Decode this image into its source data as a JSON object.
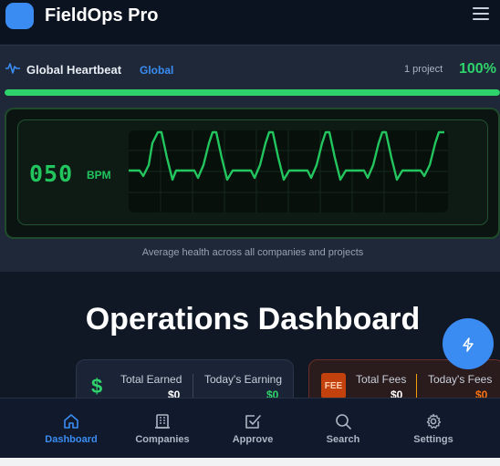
{
  "header": {
    "title": "FieldOps Pro",
    "logo_icon": "app-logo",
    "menu_icon": "hamburger-menu-icon"
  },
  "heartbeat": {
    "title": "Global Heartbeat",
    "scope": "Global",
    "project_count": "1 project",
    "health_percent": "100%",
    "health_fraction": 1.0,
    "bpm": "050",
    "bpm_unit": "BPM",
    "caption": "Average health across all companies and projects",
    "colors": {
      "ok": "#2fd36b",
      "accent": "#3b8cf2"
    }
  },
  "main": {
    "title": "Operations Dashboard",
    "earnings": {
      "total_label": "Total Earned",
      "total_value": "$0",
      "today_label": "Today's Earning",
      "today_value": "$0"
    },
    "fees": {
      "icon_text": "FEE",
      "total_label": "Total Fees",
      "total_value": "$0",
      "today_label": "Today's Fees",
      "today_value": "$0"
    }
  },
  "fab": {
    "icon": "lightning-icon"
  },
  "nav": [
    {
      "label": "Dashboard",
      "icon": "home-icon",
      "active": true
    },
    {
      "label": "Companies",
      "icon": "building-icon",
      "active": false
    },
    {
      "label": "Approve",
      "icon": "check-square-icon",
      "active": false
    },
    {
      "label": "Search",
      "icon": "search-icon",
      "active": false
    },
    {
      "label": "Settings",
      "icon": "gear-icon",
      "active": false
    }
  ]
}
